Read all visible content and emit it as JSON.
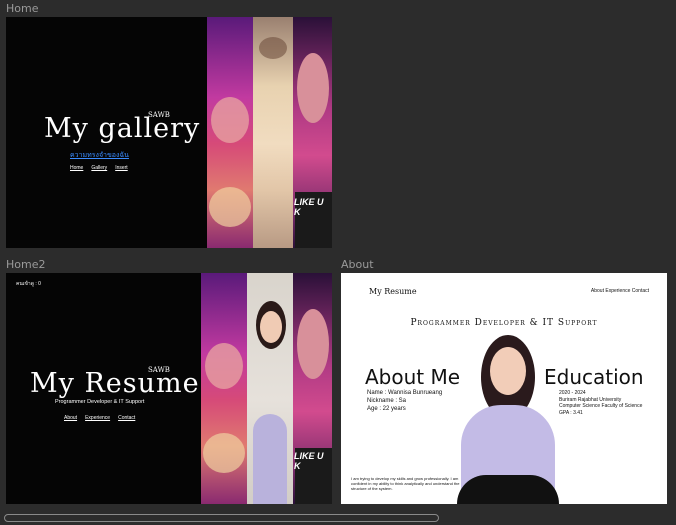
{
  "frames": {
    "home": {
      "label": "Home",
      "brand": "SAWB",
      "title": "My gallery",
      "thai_link": "ความทรงจำของฉัน",
      "nav": [
        "Home",
        "Gallery",
        "Insert"
      ],
      "photo_text": "LIKE U K"
    },
    "home2": {
      "label": "Home2",
      "counter": "คนเข้าดู : 0",
      "brand": "SAWB",
      "title": "My Resume",
      "subtitle": "Programmer Developer & IT Support",
      "nav": [
        "About",
        "Experience",
        "Contact"
      ],
      "photo_text": "LIKE U K"
    },
    "about": {
      "label": "About",
      "logo": "My Resume",
      "nav_text": "About Experience Contact",
      "heading": "Programmer Developer & IT Support",
      "about_title": "About Me",
      "name_line": "Name : Wannisa Bunrueang",
      "nickname_line": "Nickname : Sa",
      "age_line": "Age : 22 years",
      "education_title": "Education",
      "edu_years": "2020 - 2024",
      "edu_school": "Buriram Rajabhat University",
      "edu_faculty": "Computer Science Faculty of Science",
      "edu_gpa": "GPA : 3.41",
      "bio": "I am trying to develop my skills and grow professionally. I am confident in my ability to think analytically and understand the structure of the system."
    }
  },
  "colors": {
    "canvas": "#2c2c2c",
    "link_blue": "#3b8cff"
  }
}
